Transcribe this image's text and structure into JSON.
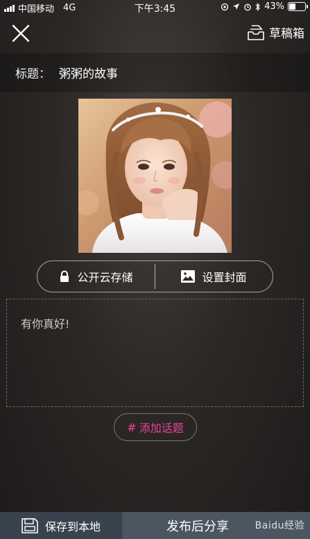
{
  "status_bar": {
    "carrier": "中国移动",
    "network": "4G",
    "time": "下午3:45",
    "battery_percent": "43%",
    "battery_level": 0.43
  },
  "nav": {
    "close_icon": "close-icon",
    "drafts_label": "草稿箱",
    "drafts_icon": "drafts-tray-icon"
  },
  "title_bar": {
    "prefix": "标题：",
    "title": "粥粥的故事"
  },
  "cover": {
    "icon": "cover-photo"
  },
  "actions": {
    "public_storage_label": "公开云存储",
    "public_storage_icon": "lock-icon",
    "set_cover_label": "设置封面",
    "set_cover_icon": "image-icon"
  },
  "content": {
    "text": "有你真好!"
  },
  "topic": {
    "hash": "#",
    "label": "添加话题",
    "color": "#e9439a"
  },
  "bottom_bar": {
    "save_local_label": "保存到本地",
    "save_icon": "floppy-disk-icon",
    "publish_label": "发布后分享",
    "watermark": "Baidu经验"
  }
}
